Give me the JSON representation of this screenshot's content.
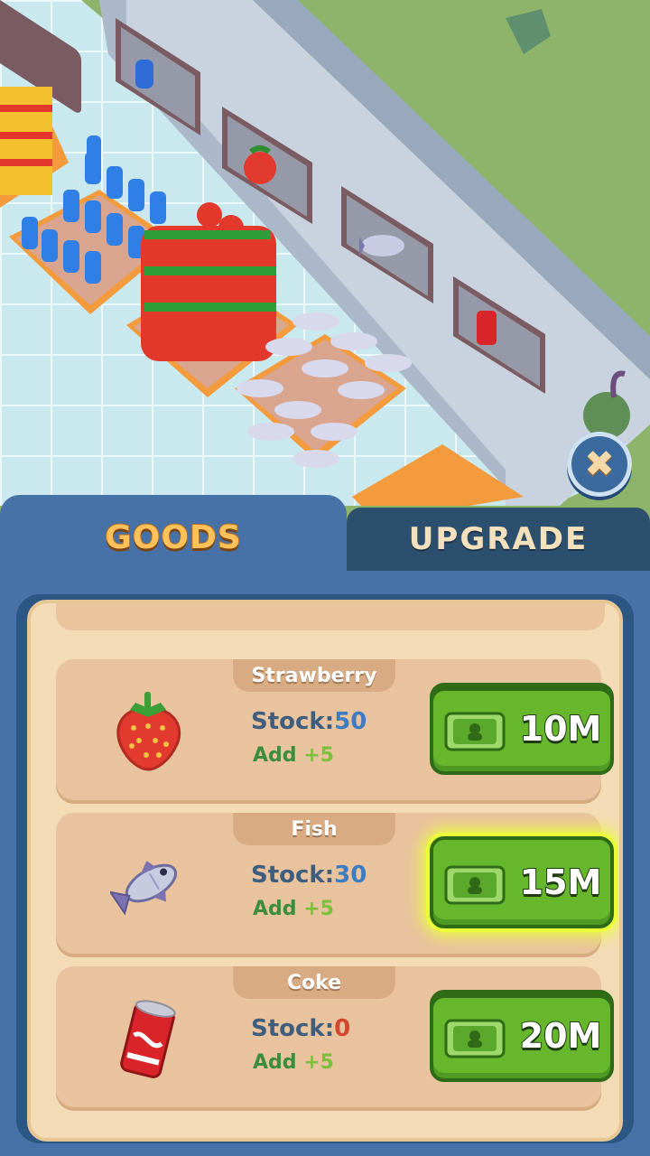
{
  "tabs": {
    "goods": "GOODS",
    "upgrade": "UPGRADE"
  },
  "close_icon": "close-icon",
  "items": [
    {
      "name": "Strawberry",
      "stock_label": "Stock:",
      "stock": "50",
      "add_label": "Add",
      "add": "+5",
      "price": "10M",
      "icon": "strawberry-icon"
    },
    {
      "name": "Fish",
      "stock_label": "Stock:",
      "stock": "30",
      "add_label": "Add",
      "add": "+5",
      "price": "15M",
      "icon": "fish-icon"
    },
    {
      "name": "Coke",
      "stock_label": "Stock:",
      "stock": "0",
      "add_label": "Add",
      "add": "+5",
      "price": "20M",
      "icon": "coke-can-icon"
    }
  ],
  "colors": {
    "panel_blue": "#4672a8",
    "tab_inactive": "#2d4f6e",
    "cream": "#f3dbb6",
    "card": "#e8c39e",
    "buy_green": "#67b72d",
    "highlight": "#eaff3a",
    "stock_blue": "#3d7cc1",
    "stock_zero": "#d3472f",
    "add_green": "#7bbf3c"
  }
}
